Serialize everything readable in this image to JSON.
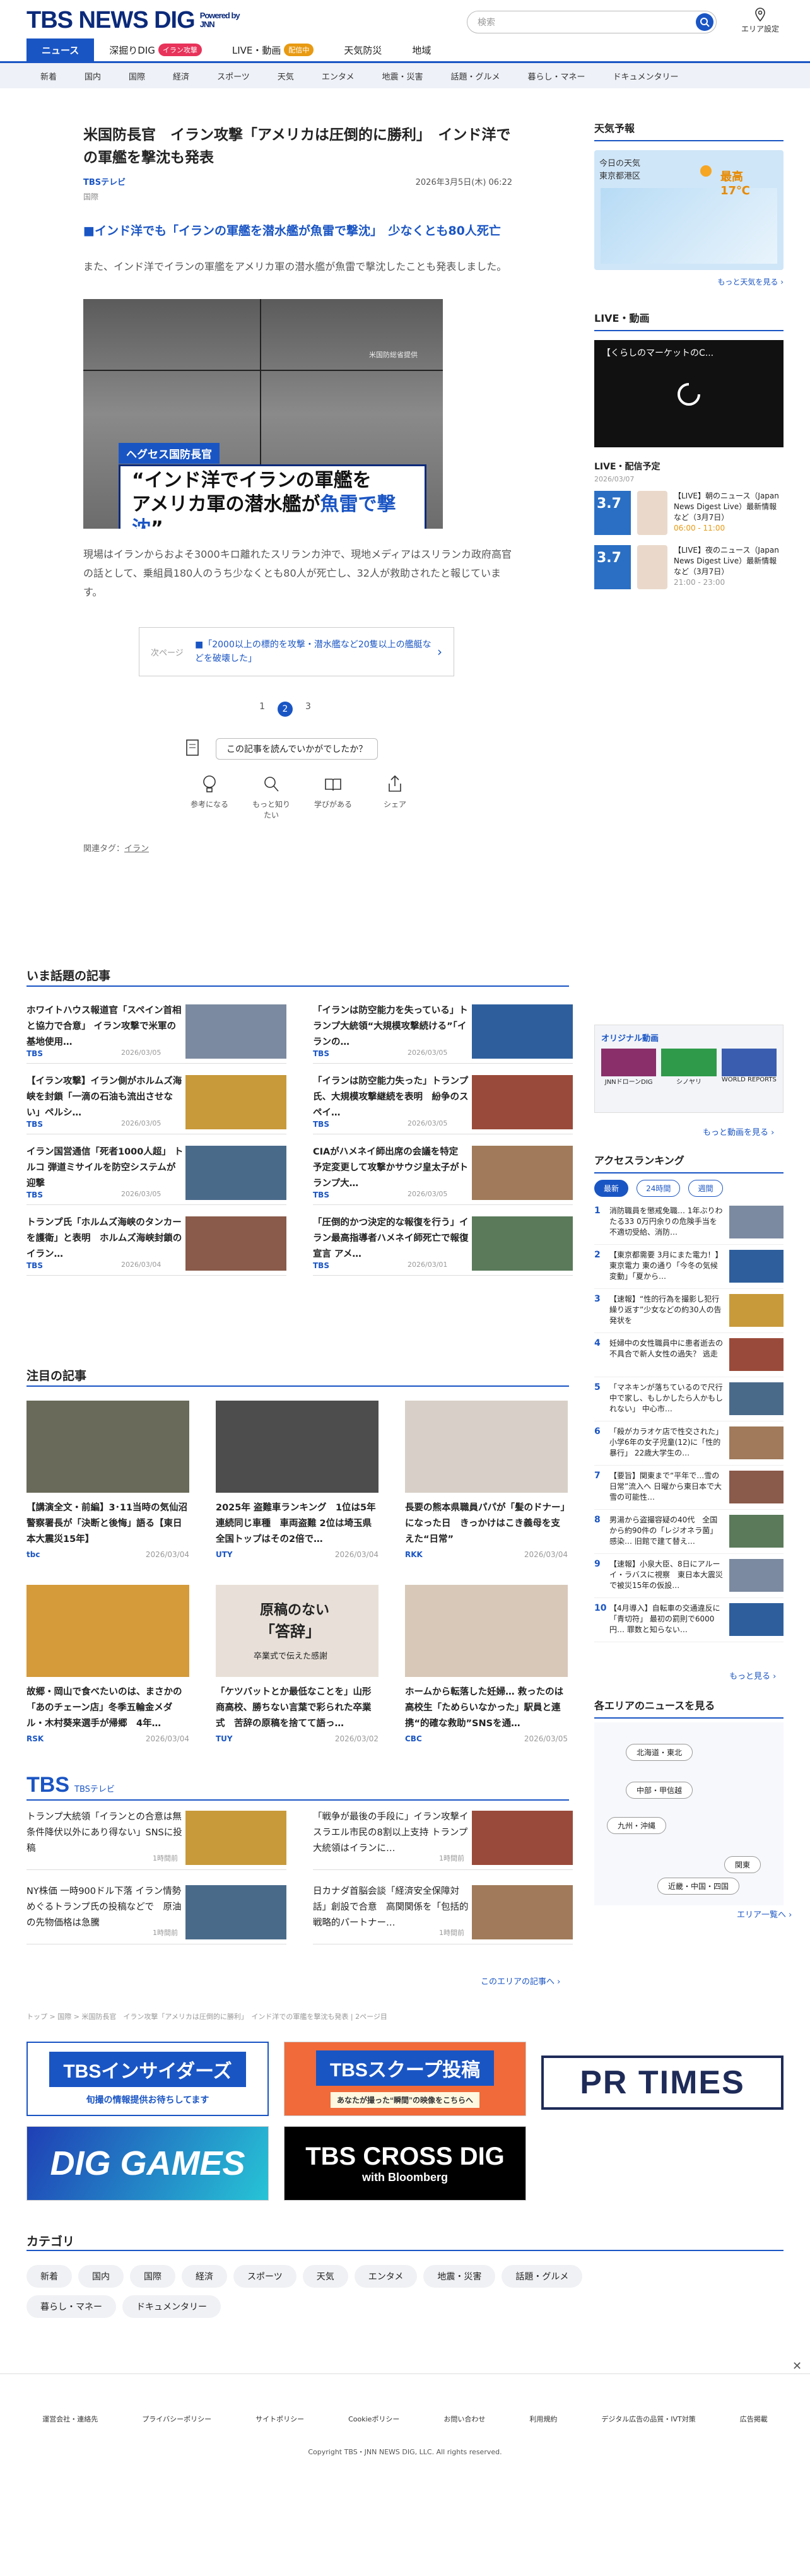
{
  "header": {
    "logo": "TBS NEWS DIG",
    "powered": "Powered by JNN",
    "search_placeholder": "検索",
    "area_label": "エリア設定"
  },
  "nav_primary": [
    {
      "label": "ニュース",
      "badge": ""
    },
    {
      "label": "深掘りDIG",
      "badge": "イラン攻撃"
    },
    {
      "label": "LIVE・動画",
      "badge": "配信中"
    },
    {
      "label": "天気防災",
      "badge": ""
    },
    {
      "label": "地域",
      "badge": ""
    }
  ],
  "nav_secondary": [
    "新着",
    "国内",
    "国際",
    "経済",
    "スポーツ",
    "天気",
    "エンタメ",
    "地震・災害",
    "話題・グルメ",
    "暮らし・マネー",
    "ドキュメンタリー"
  ],
  "article": {
    "title": "米国防長官　イラン攻撃「アメリカは圧倒的に勝利」　インド洋での軍艦を撃沈も発表",
    "source": "TBSテレビ",
    "date": "2026年3月5日(木) 06:22",
    "category": "国際",
    "subheading": "■インド洋でも「イランの軍艦を潜水艦が魚雷で撃沈」　少なくとも80人死亡",
    "para1": "また、インド洋でイランの軍艦をアメリカ軍の潜水艦が魚雷で撃沈したことも発表しました。",
    "video_caption_tag": "ヘグセス国防長官",
    "video_caption_line1": "“インド洋でイランの軍艦を",
    "video_caption_line2": "アメリカ軍の潜水艦が",
    "video_caption_hl": "魚雷で撃沈",
    "video_caption_end": "”",
    "video_watermark": "米国防総省提供",
    "para2": "現場はイランからおよそ3000キロ離れたスリランカ沖で、現地メディアはスリランカ政府高官の話として、乗組員180人のうち少なくとも80人が死亡し、32人が救助されたと報じています。",
    "next_label": "次ページ",
    "next_text": "■「2000以上の標的を攻撃・潜水艦など20隻以上の艦艇などを破壊した」",
    "pages": [
      "1",
      "2",
      "3"
    ],
    "feedback": "この記事を読んでいかがでしたか？",
    "reactions": [
      "参考になる",
      "もっと知りたい",
      "学びがある",
      "シェア"
    ],
    "tags_label": "関連タグ：",
    "tag": "イラン"
  },
  "hot": {
    "heading": "いま話題の記事",
    "items": [
      {
        "title": "ホワイトハウス報道官「スペイン首相と協力で合意」 イラン攻撃で米軍の基地使用…",
        "src": "TBS",
        "date": "2026/03/05"
      },
      {
        "title": "「イランは防空能力を失っている」トランプ大統領“大規模攻撃続ける”「イランの…",
        "src": "TBS",
        "date": "2026/03/05"
      },
      {
        "title": "【イラン攻撃】イラン側がホルムズ海峡を封鎖「一滴の石油も流出させない」ペルシ…",
        "src": "TBS",
        "date": "2026/03/05"
      },
      {
        "title": "「イランは防空能力失った」トランプ氏、大規模攻撃継続を表明　紛争のスペイ…",
        "src": "TBS",
        "date": "2026/03/05"
      },
      {
        "title": "イラン国営通信「死者1000人超」 トルコ 弾道ミサイルを防空システムが迎撃",
        "src": "TBS",
        "date": "2026/03/05"
      },
      {
        "title": "CIAがハメネイ師出席の会議を特定　予定変更して攻撃かサウジ皇太子がトランプ大…",
        "src": "TBS",
        "date": "2026/03/05"
      },
      {
        "title": "トランプ氏「ホルムズ海峡のタンカーを護衛」と表明　ホルムズ海峡封鎖のイラン…",
        "src": "TBS",
        "date": "2026/03/04"
      },
      {
        "title": "「圧倒的かつ決定的な報復を行う」イラン最高指導者ハメネイ師死亡で報復宣言 アメ…",
        "src": "TBS",
        "date": "2026/03/01"
      }
    ]
  },
  "featured": {
    "heading": "注目の記事",
    "items": [
      {
        "title": "【講演全文・前編】3･11当時の気仙沼警察署長が「決断と後悔」語る【東日本大震災15年】",
        "src": "tbc",
        "date": "2026/03/04"
      },
      {
        "title": "2025年 盗難車ランキング　1位は5年連続同じ車種　車両盗難 2位は埼玉県　全国トップはその2倍で…",
        "src": "UTY",
        "date": "2026/03/04"
      },
      {
        "title": "長要の熊本県職員パパが「髪のドナー」になった日　きっかけはこき義母を支えた“日常”",
        "src": "RKK",
        "date": "2026/03/04"
      },
      {
        "title": "故郷・岡山で食べたいのは、まさかの「あのチェーン店」冬季五輪金メダル・木村葵来選手が帰郷　4年…",
        "src": "RSK",
        "date": "2026/03/04"
      },
      {
        "title": "「ケツバットとか最低なことを」山形商高校、勝ちない言葉で彩られた卒業式　苦辞の原稿を捨てて語っ…",
        "src": "TUY",
        "date": "2026/03/02"
      },
      {
        "title": "ホームから転落した妊婦… 救ったのは高校生「ためらいなかった」駅員と連携“的確な救助”SNSを通…",
        "src": "CBC",
        "date": "2026/03/05"
      }
    ],
    "thumb2_text1": "原稿のない",
    "thumb2_text2": "「答辞」",
    "thumb2_text3": "卒業式で伝えた感謝"
  },
  "tbs_block": {
    "logo": "TBS",
    "sub": "TBSテレビ",
    "items": [
      {
        "title": "トランプ大統領「イランとの合意は無条件降伏以外にあり得ない」SNSに投稿",
        "date": "1時間前"
      },
      {
        "title": "「戦争が最後の手段に」イラン攻撃イスラエル市民の8割以上支持 トランプ大統領はイランに…",
        "date": "1時間前"
      },
      {
        "title": "NY株価 一時900ドル下落 イラン情勢めぐるトランプ氏の投稿などで　原油の先物価格は急騰",
        "date": "1時間前"
      },
      {
        "title": "日カナダ首脳会談「経済安全保障対話」創設で合意　高関関係を「包括的戦略的パートナー…",
        "date": "1時間前"
      }
    ],
    "more": "このエリアの記事へ ›"
  },
  "breadcrumb": "トップ > 国際 > 米国防長官　イラン攻撃「アメリカは圧倒的に勝利」　インド洋での軍艦を撃沈も発表 | 2ページ目",
  "banners": [
    {
      "title": "TBSインサイダーズ",
      "sub": "旬撮の情報提供お待ちしてます"
    },
    {
      "title": "TBSスクープ投稿",
      "sub": "あなたが撮った“瞬間”の映像をこちらへ"
    },
    {
      "title": "PR TIMES",
      "sub": ""
    },
    {
      "title": "DIG GAMES",
      "sub": ""
    },
    {
      "title": "TBS CROSS DIG",
      "sub": "with Bloomberg"
    }
  ],
  "categories": {
    "heading": "カテゴリ",
    "items": [
      "新着",
      "国内",
      "国際",
      "経済",
      "スポーツ",
      "天気",
      "エンタメ",
      "地震・災害",
      "話題・グルメ",
      "暮らし・マネー",
      "ドキュメンタリー"
    ]
  },
  "sidebar": {
    "weather_heading": "天気予報",
    "weather_label": "今日の天気",
    "weather_area": "東京都港区",
    "weather_temp": "最高　17℃",
    "weather_more": "もっと天気を見る ›",
    "live_heading": "LIVE・動画",
    "live_title": "【くらしのマーケットのC...",
    "schedule_heading": "LIVE・配信予定",
    "schedule_date": "2026/03/07",
    "schedule": [
      {
        "date": "3.7",
        "title": "【LIVE】朝のニュース（Japan News Digest Live）最新情報など（3月7日）",
        "time": "06:00 - 11:00"
      },
      {
        "date": "3.7",
        "title": "【LIVE】夜のニュース（Japan News Digest Live）最新情報など（3月7日）",
        "time": "21:00 - 23:00"
      }
    ],
    "original_heading": "オリジナル動画",
    "original": [
      "JNNドローンDIG",
      "シノヤリ",
      "WORLD REPORTS"
    ],
    "original_more": "もっと動画を見る ›",
    "ranking_heading": "アクセスランキング",
    "ranking_tabs": [
      "最新",
      "24時間",
      "週間"
    ],
    "ranking": [
      "消防職員を懲戒免職… 1年ぶりわたる33 0万円余りの危険手当を不適切受給、消防…",
      "【東京都需要 3月にまた電力！】東京電力 東の通り「今冬の気候変動」「夏から…",
      "【速報】“性的行為を撮影し犯行繰り返す”少女などの約30人の告発状を",
      "妊婦中の女性職員中に患者逝去の不具合で新人女性の過失？ 逃走",
      "「マネキンが落ちているので尺行中で家し、もしかしたら人かもしれない」 中心市…",
      "「殺がカラオケ店で性交された」小学6年の女子児童(12)に「性的暴行」 22歳大学生の…",
      "【要旨】関東まで“平年で…雪の日常”流入へ 日曜から東日本で大雪の可能性…",
      "男湯から盗撮容疑の40代　全国から約90件の「レジオネラ菌」感染… 旧館で建て替え…",
      "【速報】小泉大臣、8日にアルーイ・ラバスに視察　東日本大震災で被災15年の仮設…",
      "【4月導入】自転車の交通違反に「青切符」 最初の罰則で6000円… 罪数と知らない…"
    ],
    "ranking_more": "もっと見る ›",
    "area_heading": "各エリアのニュースを見る",
    "areas": [
      "北海道・東北",
      "中部・甲信越",
      "九州・沖縄",
      "関東",
      "近畿・中国・四国"
    ],
    "area_more": "エリア一覧へ ›"
  },
  "footer": {
    "links": [
      "運営会社・連絡先",
      "プライバシーポリシー",
      "サイトポリシー",
      "Cookieポリシー",
      "お問い合わせ",
      "利用規約",
      "デジタル広告の品質・IVT対策",
      "広告掲載"
    ],
    "copyright": "Copyright TBS・JNN NEWS DIG, LLC. All rights reserved."
  },
  "colors": {
    "accent": "#1a55c4",
    "brand": "#0b2a7a",
    "badge": "#e8335a"
  }
}
